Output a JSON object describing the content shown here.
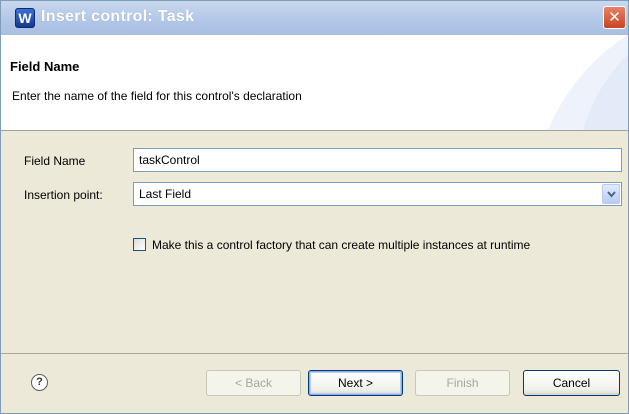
{
  "window": {
    "title": "Insert control: Task",
    "app_icon": "w-logo-icon",
    "close_icon": "close-icon"
  },
  "header": {
    "title": "Field Name",
    "description": "Enter the name of the field for this control's declaration"
  },
  "form": {
    "field_name_label": "Field Name",
    "field_name_value": "taskControl",
    "insertion_point_label": "Insertion point:",
    "insertion_point_value": "Last Field",
    "factory_checkbox_label": "Make this a control factory that can create multiple instances at runtime",
    "factory_checkbox_checked": false
  },
  "footer": {
    "help_icon": "question-mark-icon",
    "back_label": "< Back",
    "next_label": "Next >",
    "finish_label": "Finish",
    "cancel_label": "Cancel"
  },
  "colors": {
    "title_bar": "#b3c7e7",
    "close_button": "#c9431f",
    "dialog_bg": "#ece9d8",
    "field_border": "#7f9db9"
  }
}
